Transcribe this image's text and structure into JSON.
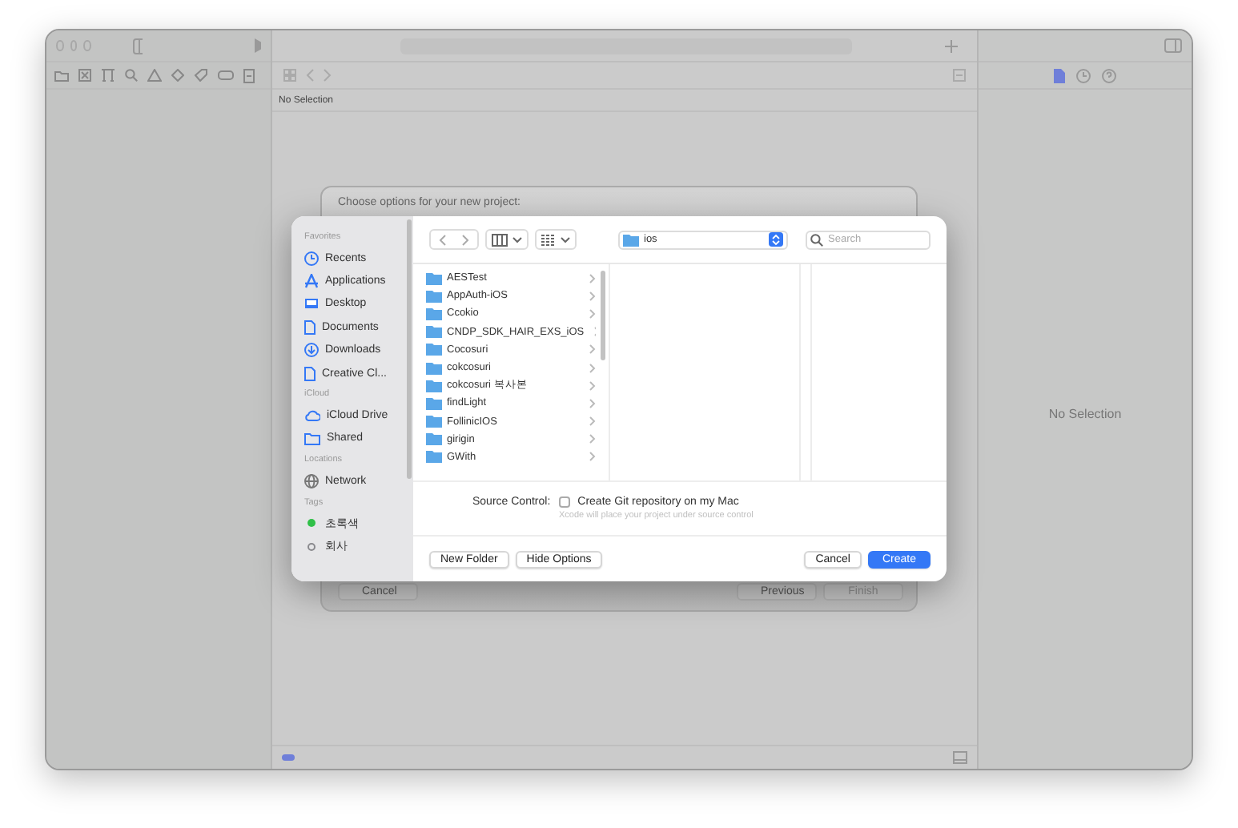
{
  "editor": {
    "breadcrumb": "No Selection"
  },
  "inspector": {
    "empty_text": "No Selection"
  },
  "sheet": {
    "title": "Choose options for your new project:",
    "buttons": [
      {
        "label": "Cancel",
        "disabled": false
      },
      {
        "label": "Previous",
        "disabled": false
      },
      {
        "label": "Finish",
        "disabled": true
      }
    ]
  },
  "dialog": {
    "sidebar": [
      {
        "heading": "Favorites",
        "items": [
          {
            "label": "Recents",
            "kind": "clock"
          },
          {
            "label": "Applications",
            "kind": "apps"
          },
          {
            "label": "Desktop",
            "kind": "desktop"
          },
          {
            "label": "Documents",
            "kind": "doc"
          },
          {
            "label": "Downloads",
            "kind": "download"
          },
          {
            "label": "Creative Cl...",
            "kind": "doc"
          }
        ]
      },
      {
        "heading": "iCloud",
        "items": [
          {
            "label": "iCloud Drive",
            "kind": "cloud"
          },
          {
            "label": "Shared",
            "kind": "shared"
          }
        ]
      },
      {
        "heading": "Locations",
        "items": [
          {
            "label": "Network",
            "kind": "globe"
          }
        ]
      },
      {
        "heading": "Tags",
        "items": [
          {
            "label": "초록색",
            "kind": "tag",
            "color": "#30c048"
          },
          {
            "label": "회사",
            "kind": "tag-empty",
            "color": "#8a8a8e"
          }
        ]
      }
    ],
    "location": "ios",
    "search": {
      "placeholder": "Search"
    },
    "folders": [
      "AESTest",
      "AppAuth-iOS",
      "Ccokio",
      "CNDP_SDK_HAIR_EXS_iOS",
      "Cocosuri",
      "cokcosuri",
      "cokcosuri 복사본",
      "findLight",
      "FollinicIOS",
      "girigin",
      "GWith"
    ],
    "source_control": {
      "label": "Source Control:",
      "option": "Create Git repository on my Mac",
      "checked": false,
      "hint": "Xcode will place your project under source control"
    },
    "buttons": [
      {
        "label": "New Folder",
        "kind": "plain"
      },
      {
        "label": "Hide Options",
        "kind": "plain"
      },
      {
        "label": "Cancel",
        "kind": "plain"
      },
      {
        "label": "Create",
        "kind": "default"
      }
    ]
  }
}
